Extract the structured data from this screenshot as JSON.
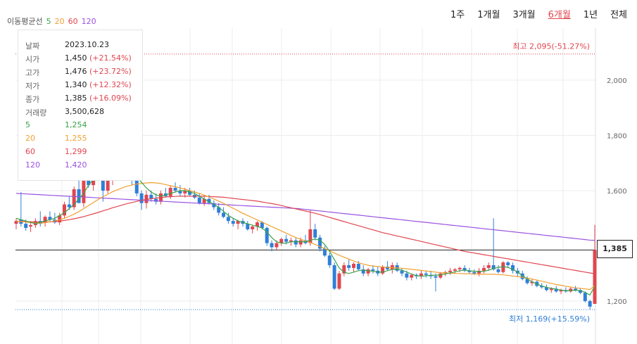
{
  "periods": {
    "items": [
      "1주",
      "1개월",
      "3개월",
      "6개월",
      "1년",
      "전체"
    ],
    "active": "6개월"
  },
  "tooltip": {
    "rows": [
      {
        "label": "날짜",
        "value": "2023.10.23"
      },
      {
        "label": "시가",
        "value": "1,450",
        "change": "(+21.54%)"
      },
      {
        "label": "고가",
        "value": "1,476",
        "change": "(+23.72%)"
      },
      {
        "label": "저가",
        "value": "1,340",
        "change": "(+12.32%)"
      },
      {
        "label": "종가",
        "value": "1,385",
        "change": "(+16.09%)"
      },
      {
        "label": "거래량",
        "value": "3,500,628"
      },
      {
        "label": "5",
        "value": "1,254"
      },
      {
        "label": "20",
        "value": "1,255"
      },
      {
        "label": "60",
        "value": "1,299"
      },
      {
        "label": "120",
        "value": "1,420"
      }
    ]
  },
  "chart_data": {
    "type": "candlestick",
    "title": "",
    "ylim": [
      1100,
      2150
    ],
    "y_ticks": [
      2000,
      1800,
      1600,
      1200
    ],
    "y_tick_labels": [
      "2,000",
      "1,800",
      "1,600",
      "1,200"
    ],
    "grid": true,
    "colors": {
      "up": "#e0464f",
      "down": "#2f7fd8",
      "ma5": "#3aa34a",
      "ma20": "#f0a030",
      "ma60": "#e0464f",
      "ma120": "#9a52e0",
      "grid": "#ececec"
    },
    "legend": {
      "title": "이동평균선",
      "items": [
        {
          "label": "5",
          "period": 5
        },
        {
          "label": "20",
          "period": 20
        },
        {
          "label": "60",
          "period": 60
        },
        {
          "label": "120",
          "period": 120
        }
      ]
    },
    "current_price": 1385,
    "current_price_label": "1,385",
    "annotations": {
      "high": {
        "value": 2095,
        "label": "최고 2,095(-51.27%)"
      },
      "low": {
        "value": 1169,
        "label": "최저 1,169(+15.59%)"
      }
    },
    "series": {
      "ohlc": [
        [
          1480,
          1500,
          1460,
          1490
        ],
        [
          1495,
          1595,
          1470,
          1480
        ],
        [
          1480,
          1495,
          1455,
          1465
        ],
        [
          1470,
          1490,
          1450,
          1475
        ],
        [
          1475,
          1500,
          1465,
          1490
        ],
        [
          1490,
          1525,
          1470,
          1480
        ],
        [
          1485,
          1510,
          1470,
          1505
        ],
        [
          1505,
          1525,
          1485,
          1495
        ],
        [
          1495,
          1520,
          1480,
          1485
        ],
        [
          1485,
          1520,
          1475,
          1510
        ],
        [
          1510,
          1560,
          1500,
          1550
        ],
        [
          1550,
          1580,
          1530,
          1540
        ],
        [
          1540,
          1615,
          1530,
          1605
        ],
        [
          1605,
          1640,
          1580,
          1555
        ],
        [
          1555,
          1690,
          1540,
          1680
        ],
        [
          1680,
          1720,
          1610,
          1620
        ],
        [
          1620,
          1680,
          1600,
          1670
        ],
        [
          1670,
          1720,
          1640,
          1710
        ],
        [
          1710,
          1760,
          1560,
          1600
        ],
        [
          1600,
          1700,
          1590,
          1660
        ],
        [
          1660,
          1740,
          1620,
          1720
        ],
        [
          1720,
          1760,
          1660,
          1680
        ],
        [
          1680,
          1700,
          1640,
          1660
        ],
        [
          1660,
          1710,
          1640,
          1690
        ],
        [
          1690,
          1705,
          1620,
          1640
        ],
        [
          1640,
          1650,
          1580,
          1590
        ],
        [
          1590,
          1600,
          1530,
          1555
        ],
        [
          1555,
          1600,
          1535,
          1585
        ],
        [
          1585,
          1600,
          1560,
          1570
        ],
        [
          1570,
          1590,
          1550,
          1560
        ],
        [
          1560,
          1600,
          1550,
          1590
        ],
        [
          1590,
          1610,
          1575,
          1580
        ],
        [
          1580,
          1620,
          1570,
          1610
        ],
        [
          1610,
          1630,
          1595,
          1600
        ],
        [
          1600,
          1620,
          1580,
          1590
        ],
        [
          1590,
          1610,
          1575,
          1600
        ],
        [
          1600,
          1610,
          1580,
          1585
        ],
        [
          1585,
          1600,
          1570,
          1575
        ],
        [
          1575,
          1590,
          1550,
          1555
        ],
        [
          1555,
          1580,
          1545,
          1570
        ],
        [
          1570,
          1585,
          1550,
          1555
        ],
        [
          1555,
          1565,
          1530,
          1540
        ],
        [
          1540,
          1555,
          1510,
          1520
        ],
        [
          1520,
          1540,
          1500,
          1505
        ],
        [
          1505,
          1520,
          1480,
          1490
        ],
        [
          1490,
          1500,
          1470,
          1480
        ],
        [
          1480,
          1495,
          1460,
          1490
        ],
        [
          1490,
          1500,
          1470,
          1480
        ],
        [
          1480,
          1490,
          1455,
          1460
        ],
        [
          1460,
          1475,
          1445,
          1470
        ],
        [
          1470,
          1490,
          1455,
          1485
        ],
        [
          1485,
          1490,
          1460,
          1465
        ],
        [
          1465,
          1470,
          1400,
          1410
        ],
        [
          1410,
          1420,
          1380,
          1395
        ],
        [
          1395,
          1420,
          1385,
          1410
        ],
        [
          1410,
          1430,
          1400,
          1425
        ],
        [
          1425,
          1440,
          1405,
          1415
        ],
        [
          1415,
          1430,
          1400,
          1420
        ],
        [
          1420,
          1430,
          1395,
          1405
        ],
        [
          1405,
          1430,
          1395,
          1420
        ],
        [
          1420,
          1440,
          1405,
          1410
        ],
        [
          1410,
          1530,
          1400,
          1460
        ],
        [
          1460,
          1480,
          1420,
          1430
        ],
        [
          1430,
          1440,
          1380,
          1390
        ],
        [
          1390,
          1400,
          1360,
          1365
        ],
        [
          1365,
          1375,
          1320,
          1330
        ],
        [
          1330,
          1340,
          1240,
          1245
        ],
        [
          1245,
          1310,
          1240,
          1300
        ],
        [
          1300,
          1340,
          1290,
          1330
        ],
        [
          1330,
          1350,
          1310,
          1320
        ],
        [
          1320,
          1340,
          1305,
          1335
        ],
        [
          1335,
          1345,
          1310,
          1315
        ],
        [
          1315,
          1330,
          1290,
          1300
        ],
        [
          1300,
          1320,
          1290,
          1315
        ],
        [
          1315,
          1330,
          1300,
          1310
        ],
        [
          1310,
          1325,
          1290,
          1300
        ],
        [
          1300,
          1330,
          1295,
          1325
        ],
        [
          1325,
          1345,
          1310,
          1315
        ],
        [
          1315,
          1340,
          1300,
          1330
        ],
        [
          1330,
          1340,
          1305,
          1310
        ],
        [
          1310,
          1320,
          1290,
          1300
        ],
        [
          1300,
          1310,
          1275,
          1285
        ],
        [
          1285,
          1300,
          1275,
          1295
        ],
        [
          1295,
          1300,
          1280,
          1290
        ],
        [
          1290,
          1310,
          1280,
          1300
        ],
        [
          1300,
          1310,
          1285,
          1295
        ],
        [
          1295,
          1310,
          1280,
          1290
        ],
        [
          1290,
          1300,
          1235,
          1285
        ],
        [
          1285,
          1305,
          1280,
          1300
        ],
        [
          1300,
          1310,
          1290,
          1305
        ],
        [
          1305,
          1320,
          1295,
          1310
        ],
        [
          1310,
          1320,
          1300,
          1315
        ],
        [
          1315,
          1325,
          1305,
          1320
        ],
        [
          1320,
          1330,
          1305,
          1310
        ],
        [
          1310,
          1320,
          1300,
          1305
        ],
        [
          1305,
          1315,
          1295,
          1300
        ],
        [
          1300,
          1320,
          1290,
          1310
        ],
        [
          1310,
          1330,
          1300,
          1320
        ],
        [
          1320,
          1340,
          1310,
          1330
        ],
        [
          1330,
          1500,
          1310,
          1315
        ],
        [
          1315,
          1330,
          1300,
          1305
        ],
        [
          1305,
          1345,
          1300,
          1340
        ],
        [
          1340,
          1345,
          1320,
          1330
        ],
        [
          1330,
          1340,
          1300,
          1310
        ],
        [
          1310,
          1320,
          1290,
          1300
        ],
        [
          1300,
          1310,
          1275,
          1280
        ],
        [
          1280,
          1290,
          1260,
          1265
        ],
        [
          1265,
          1280,
          1255,
          1270
        ],
        [
          1270,
          1275,
          1250,
          1255
        ],
        [
          1255,
          1265,
          1245,
          1250
        ],
        [
          1250,
          1260,
          1235,
          1240
        ],
        [
          1240,
          1250,
          1230,
          1245
        ],
        [
          1245,
          1255,
          1230,
          1235
        ],
        [
          1235,
          1245,
          1225,
          1240
        ],
        [
          1240,
          1250,
          1230,
          1235
        ],
        [
          1235,
          1250,
          1230,
          1245
        ],
        [
          1245,
          1255,
          1235,
          1240
        ],
        [
          1240,
          1245,
          1225,
          1230
        ],
        [
          1230,
          1235,
          1195,
          1200
        ],
        [
          1200,
          1205,
          1169,
          1180
        ],
        [
          1190,
          1476,
          1340,
          1385
        ]
      ],
      "ma5": [
        1500,
        1495,
        1490,
        1485,
        1480,
        1485,
        1490,
        1495,
        1500,
        1510,
        1520,
        1535,
        1550,
        1570,
        1590,
        1620,
        1640,
        1660,
        1670,
        1665,
        1670,
        1680,
        1685,
        1680,
        1670,
        1650,
        1630,
        1610,
        1595,
        1585,
        1580,
        1585,
        1590,
        1595,
        1600,
        1600,
        1595,
        1590,
        1580,
        1570,
        1560,
        1550,
        1540,
        1525,
        1510,
        1500,
        1490,
        1485,
        1480,
        1475,
        1470,
        1465,
        1450,
        1430,
        1415,
        1410,
        1410,
        1415,
        1415,
        1415,
        1415,
        1420,
        1425,
        1420,
        1405,
        1380,
        1350,
        1320,
        1305,
        1300,
        1305,
        1310,
        1312,
        1310,
        1308,
        1305,
        1305,
        1310,
        1315,
        1315,
        1312,
        1305,
        1298,
        1292,
        1290,
        1292,
        1293,
        1294,
        1295,
        1298,
        1302,
        1306,
        1310,
        1312,
        1310,
        1308,
        1307,
        1308,
        1312,
        1318,
        1322,
        1325,
        1322,
        1315,
        1305,
        1292,
        1280,
        1270,
        1262,
        1255,
        1250,
        1246,
        1243,
        1240,
        1238,
        1238,
        1239,
        1238,
        1232,
        1222,
        1254
      ],
      "ma20": [
        1490,
        1488,
        1486,
        1484,
        1482,
        1482,
        1484,
        1487,
        1490,
        1494,
        1500,
        1507,
        1515,
        1524,
        1535,
        1546,
        1557,
        1568,
        1578,
        1587,
        1596,
        1603,
        1610,
        1616,
        1620,
        1624,
        1626,
        1628,
        1629,
        1628,
        1626,
        1622,
        1618,
        1614,
        1610,
        1605,
        1600,
        1595,
        1590,
        1584,
        1577,
        1570,
        1562,
        1554,
        1545,
        1536,
        1527,
        1518,
        1510,
        1502,
        1494,
        1486,
        1478,
        1470,
        1462,
        1454,
        1446,
        1438,
        1430,
        1424,
        1418,
        1412,
        1405,
        1398,
        1390,
        1382,
        1374,
        1366,
        1359,
        1352,
        1345,
        1339,
        1334,
        1330,
        1327,
        1325,
        1323,
        1322,
        1321,
        1320,
        1319,
        1317,
        1315,
        1313,
        1311,
        1309,
        1307,
        1305,
        1303,
        1302,
        1301,
        1300,
        1300,
        1299,
        1299,
        1298,
        1298,
        1297,
        1297,
        1297,
        1296,
        1295,
        1293,
        1291,
        1289,
        1286,
        1283,
        1280,
        1276,
        1272,
        1268,
        1264,
        1260,
        1257,
        1254,
        1251,
        1248,
        1246,
        1244,
        1242,
        1255
      ],
      "ma60": [
        1490,
        1489,
        1488,
        1487,
        1486,
        1486,
        1486,
        1487,
        1488,
        1490,
        1492,
        1495,
        1498,
        1502,
        1506,
        1511,
        1516,
        1521,
        1527,
        1532,
        1538,
        1543,
        1548,
        1553,
        1557,
        1561,
        1565,
        1568,
        1571,
        1573,
        1575,
        1577,
        1578,
        1579,
        1580,
        1580,
        1580,
        1580,
        1580,
        1580,
        1579,
        1578,
        1577,
        1576,
        1574,
        1572,
        1570,
        1568,
        1566,
        1564,
        1562,
        1559,
        1556,
        1553,
        1550,
        1546,
        1542,
        1538,
        1534,
        1530,
        1526,
        1522,
        1518,
        1513,
        1508,
        1503,
        1498,
        1493,
        1488,
        1483,
        1478,
        1473,
        1468,
        1463,
        1458,
        1453,
        1448,
        1444,
        1440,
        1436,
        1432,
        1428,
        1424,
        1420,
        1416,
        1412,
        1408,
        1404,
        1400,
        1396,
        1392,
        1388,
        1384,
        1380,
        1377,
        1374,
        1371,
        1368,
        1365,
        1362,
        1359,
        1356,
        1353,
        1350,
        1347,
        1344,
        1341,
        1338,
        1335,
        1332,
        1329,
        1326,
        1323,
        1320,
        1317,
        1314,
        1311,
        1308,
        1305,
        1302,
        1299
      ],
      "ma120": [
        1590,
        1589,
        1588,
        1587,
        1586,
        1585,
        1584,
        1583,
        1582,
        1581,
        1580,
        1579,
        1578,
        1577,
        1576,
        1575,
        1574,
        1573,
        1572,
        1571,
        1570,
        1569,
        1568,
        1567,
        1566,
        1565,
        1564,
        1563,
        1562,
        1561,
        1560,
        1559,
        1558,
        1557,
        1556,
        1555,
        1554,
        1553,
        1552,
        1551,
        1550,
        1549,
        1548,
        1547,
        1546,
        1545,
        1544,
        1543,
        1542,
        1541,
        1540,
        1539,
        1538,
        1537,
        1536,
        1535,
        1533,
        1531,
        1529,
        1527,
        1525,
        1523,
        1521,
        1519,
        1517,
        1515,
        1513,
        1511,
        1509,
        1507,
        1505,
        1503,
        1501,
        1499,
        1497,
        1495,
        1493,
        1491,
        1489,
        1487,
        1485,
        1483,
        1481,
        1479,
        1477,
        1475,
        1473,
        1471,
        1469,
        1467,
        1465,
        1463,
        1461,
        1459,
        1457,
        1455,
        1453,
        1451,
        1449,
        1447,
        1445,
        1443,
        1441,
        1439,
        1437,
        1435,
        1433,
        1431,
        1429,
        1427,
        1425,
        1423,
        1421,
        1420
      ]
    }
  }
}
